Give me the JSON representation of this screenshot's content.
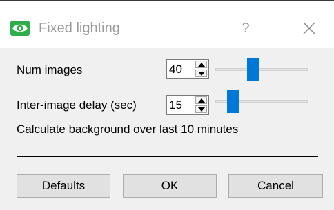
{
  "window": {
    "title": "Fixed lighting",
    "help_glyph": "?",
    "app_icon": "eye-icon",
    "close_icon": "close-icon",
    "accent": "#2dae48"
  },
  "settings": {
    "num_images": {
      "label": "Num images",
      "value": "40",
      "slider_level": 0.4
    },
    "inter_image_delay": {
      "label": "Inter-image delay (sec)",
      "value": "15",
      "slider_level": 0.15
    },
    "info": "Calculate background over last 10 minutes"
  },
  "buttons": {
    "defaults": "Defaults",
    "ok": "OK",
    "cancel": "Cancel"
  },
  "colors": {
    "slider_thumb": "#0078d7"
  }
}
